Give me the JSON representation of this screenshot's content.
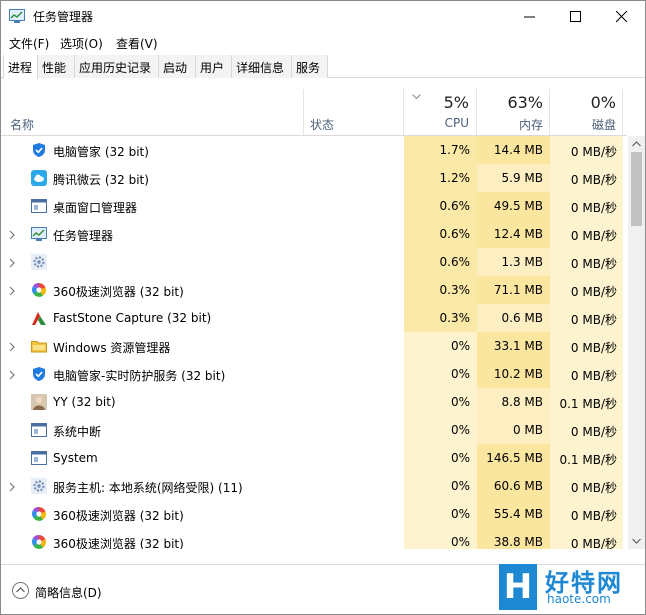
{
  "window": {
    "title": "任务管理器",
    "controls": [
      "minimize",
      "maximize",
      "close"
    ]
  },
  "menu": [
    "文件(F)",
    "选项(O)",
    "查看(V)"
  ],
  "tabs": [
    "进程",
    "性能",
    "应用历史记录",
    "启动",
    "用户",
    "详细信息",
    "服务"
  ],
  "active_tab": 0,
  "columns": {
    "name": "名称",
    "status": "状态",
    "cpu": {
      "pct": "5%",
      "label": "CPU"
    },
    "memory": {
      "pct": "63%",
      "label": "内存"
    },
    "disk": {
      "pct": "0%",
      "label": "磁盘"
    }
  },
  "processes": [
    {
      "name": "电脑管家 (32 bit)",
      "icon": "shield-icon",
      "expandable": false,
      "cpu": "1.7%",
      "mem": "14.4 MB",
      "disk": "0 MB/秒"
    },
    {
      "name": "腾讯微云 (32 bit)",
      "icon": "cloud-icon",
      "expandable": false,
      "cpu": "1.2%",
      "mem": "5.9 MB",
      "disk": "0 MB/秒"
    },
    {
      "name": "桌面窗口管理器",
      "icon": "window-icon",
      "expandable": false,
      "cpu": "0.6%",
      "mem": "49.5 MB",
      "disk": "0 MB/秒"
    },
    {
      "name": "任务管理器",
      "icon": "task-manager-icon",
      "expandable": true,
      "cpu": "0.6%",
      "mem": "12.4 MB",
      "disk": "0 MB/秒"
    },
    {
      "name": "",
      "icon": "gear-icon",
      "expandable": true,
      "cpu": "0.6%",
      "mem": "1.3 MB",
      "disk": "0 MB/秒"
    },
    {
      "name": "360极速浏览器 (32 bit)",
      "icon": "browser-icon",
      "expandable": true,
      "cpu": "0.3%",
      "mem": "71.1 MB",
      "disk": "0 MB/秒"
    },
    {
      "name": "FastStone Capture (32 bit)",
      "icon": "capture-icon",
      "expandable": false,
      "cpu": "0.3%",
      "mem": "0.6 MB",
      "disk": "0 MB/秒"
    },
    {
      "name": "Windows 资源管理器",
      "icon": "folder-icon",
      "expandable": true,
      "cpu": "0%",
      "mem": "33.1 MB",
      "disk": "0 MB/秒"
    },
    {
      "name": "电脑管家-实时防护服务 (32 bit)",
      "icon": "shield-icon",
      "expandable": true,
      "cpu": "0%",
      "mem": "10.2 MB",
      "disk": "0 MB/秒"
    },
    {
      "name": "YY (32 bit)",
      "icon": "yy-icon",
      "expandable": false,
      "cpu": "0%",
      "mem": "8.8 MB",
      "disk": "0.1 MB/秒"
    },
    {
      "name": "系统中断",
      "icon": "window-icon",
      "expandable": false,
      "cpu": "0%",
      "mem": "0 MB",
      "disk": "0 MB/秒"
    },
    {
      "name": "System",
      "icon": "window-icon",
      "expandable": false,
      "cpu": "0%",
      "mem": "146.5 MB",
      "disk": "0.1 MB/秒"
    },
    {
      "name": "服务主机: 本地系统(网络受限) (11)",
      "icon": "gear-icon",
      "expandable": true,
      "cpu": "0%",
      "mem": "60.6 MB",
      "disk": "0 MB/秒"
    },
    {
      "name": "360极速浏览器 (32 bit)",
      "icon": "browser-icon",
      "expandable": false,
      "cpu": "0%",
      "mem": "55.4 MB",
      "disk": "0 MB/秒"
    },
    {
      "name": "360极速浏览器 (32 bit)",
      "icon": "browser-icon",
      "expandable": false,
      "cpu": "0%",
      "mem": "38.8 MB",
      "disk": "0 MB/秒"
    }
  ],
  "footer": {
    "fewer_details": "简略信息(D)"
  },
  "watermark": {
    "text": "好特网",
    "url": "haote.com",
    "logo_letter": "H"
  },
  "colors": {
    "cpu_high": "#fbe9a8",
    "cpu_low": "#fdf4cf",
    "mem_high": "#fbe6a0",
    "mem_mid": "#fdefc2",
    "accent": "#1e88d2"
  }
}
